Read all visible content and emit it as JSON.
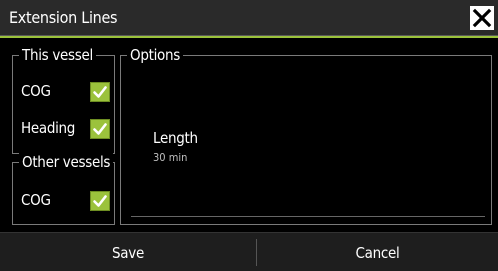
{
  "window": {
    "title": "Extension Lines",
    "close_icon": "close-icon"
  },
  "colors": {
    "accent": "#9bc23c",
    "background": "#000000",
    "titlebar": "#2a2a2a",
    "footer": "#1e1e1e",
    "group_border": "#7a7a7a"
  },
  "this_vessel": {
    "legend": "This vessel",
    "items": [
      {
        "label": "COG",
        "checked": true
      },
      {
        "label": "Heading",
        "checked": true
      }
    ]
  },
  "other_vessels": {
    "legend": "Other vessels",
    "items": [
      {
        "label": "COG",
        "checked": true
      }
    ]
  },
  "options": {
    "legend": "Options",
    "length": {
      "label": "Length",
      "value": "30 min"
    }
  },
  "footer": {
    "save_label": "Save",
    "cancel_label": "Cancel"
  }
}
